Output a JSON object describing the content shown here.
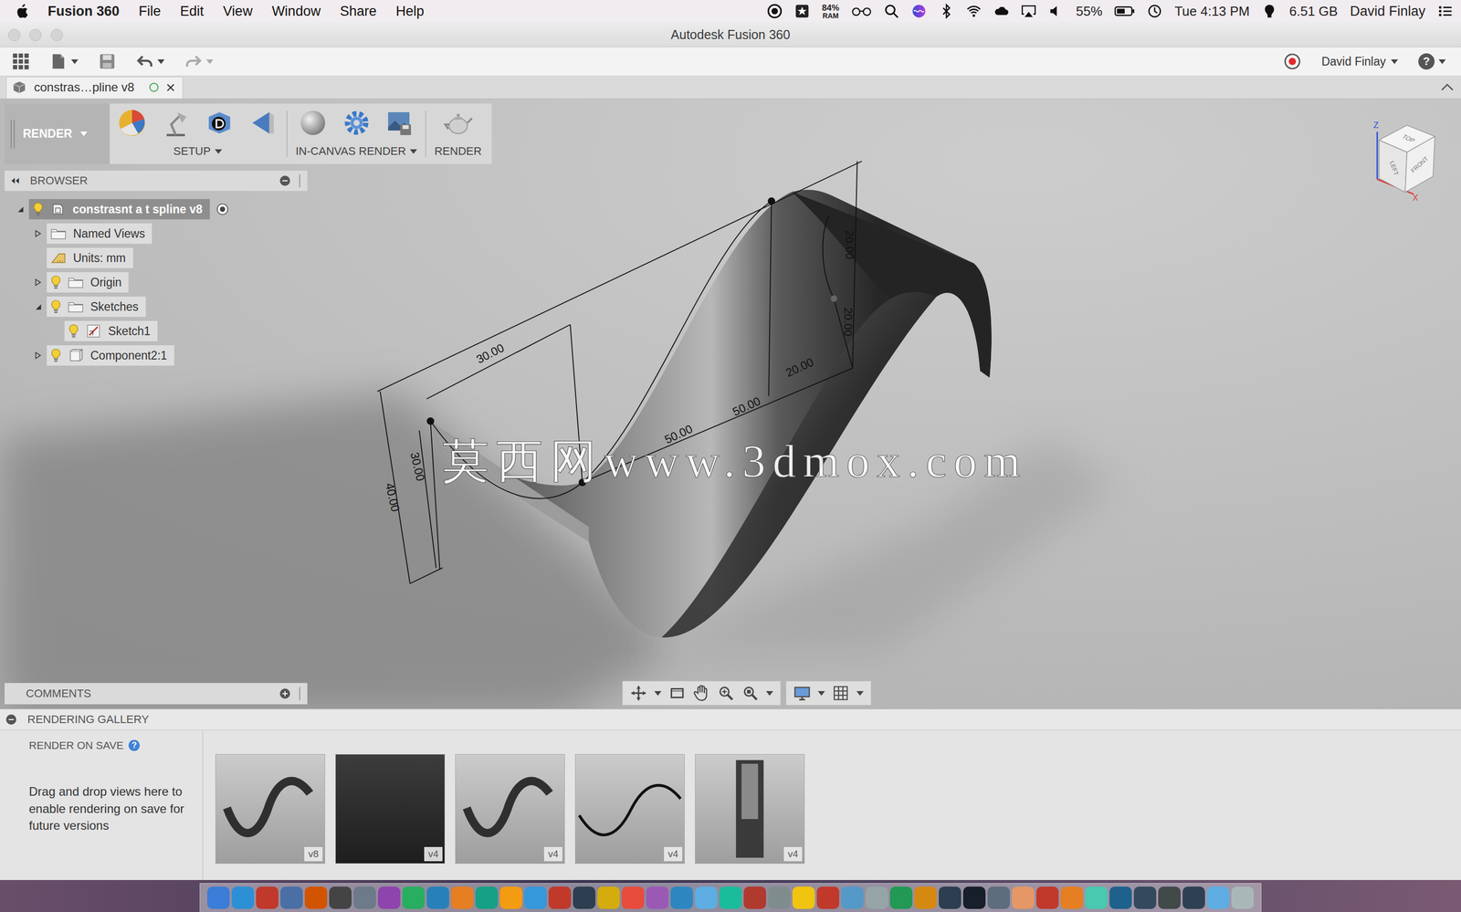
{
  "menu_bar": {
    "app": "Fusion 360",
    "menus": [
      "File",
      "Edit",
      "View",
      "Window",
      "Share",
      "Help"
    ],
    "ram": {
      "value": "84%",
      "label": "RAM"
    },
    "battery": "55%",
    "clock": "Tue 4:13 PM",
    "memory": "6.51 GB",
    "user": "David Finlay"
  },
  "window": {
    "title": "Autodesk Fusion 360"
  },
  "toolbar": {
    "user": "David Finlay",
    "help": "?"
  },
  "document_tab": {
    "label": "constras…pline v8",
    "close": "×",
    "selected": true
  },
  "render_toolbar": {
    "workspace": "RENDER",
    "groups": [
      {
        "label": "SETUP",
        "dropdown": true
      },
      {
        "label": "IN-CANVAS RENDER",
        "dropdown": true
      },
      {
        "label": "RENDER",
        "dropdown": false
      }
    ]
  },
  "browser": {
    "title": "BROWSER",
    "items": [
      {
        "label": "constrasnt a t spline v8",
        "kind": "root",
        "depth": 0,
        "expandable": true,
        "expanded": true,
        "has_visibility": true,
        "selected": true
      },
      {
        "label": "Named Views",
        "kind": "folder",
        "depth": 1,
        "expandable": true,
        "expanded": false,
        "has_visibility": false,
        "selected": false
      },
      {
        "label": "Units: mm",
        "kind": "units",
        "depth": 1,
        "expandable": false,
        "expanded": false,
        "has_visibility": false,
        "selected": false
      },
      {
        "label": "Origin",
        "kind": "folder",
        "depth": 1,
        "expandable": true,
        "expanded": false,
        "has_visibility": true,
        "selected": false
      },
      {
        "label": "Sketches",
        "kind": "folder",
        "depth": 1,
        "expandable": true,
        "expanded": true,
        "has_visibility": true,
        "selected": false
      },
      {
        "label": "Sketch1",
        "kind": "sketch",
        "depth": 2,
        "expandable": false,
        "expanded": false,
        "has_visibility": true,
        "selected": false
      },
      {
        "label": "Component2:1",
        "kind": "component",
        "depth": 1,
        "expandable": true,
        "expanded": false,
        "has_visibility": true,
        "selected": false
      }
    ]
  },
  "comments": {
    "title": "COMMENTS"
  },
  "viewcube": {
    "faces": [
      "TOP",
      "LEFT",
      "FRONT"
    ],
    "axes": [
      "Z",
      "X"
    ]
  },
  "sketch": {
    "dimensions": [
      "30.00",
      "40.00",
      "30.00",
      "50.00",
      "50.00",
      "20.00",
      "20.00",
      "20.00"
    ]
  },
  "watermark": "莫西网www.3dmox.com",
  "gallery": {
    "title": "RENDERING GALLERY",
    "render_on_save": "RENDER ON SAVE",
    "help": "?",
    "hint": "Drag and drop views here to enable rendering on save for future versions",
    "thumbnails": [
      {
        "version": "v8",
        "kind": "chair"
      },
      {
        "version": "v4",
        "kind": "dark"
      },
      {
        "version": "v4",
        "kind": "chair"
      },
      {
        "version": "v4",
        "kind": "wave"
      },
      {
        "version": "v4",
        "kind": "front"
      }
    ]
  }
}
